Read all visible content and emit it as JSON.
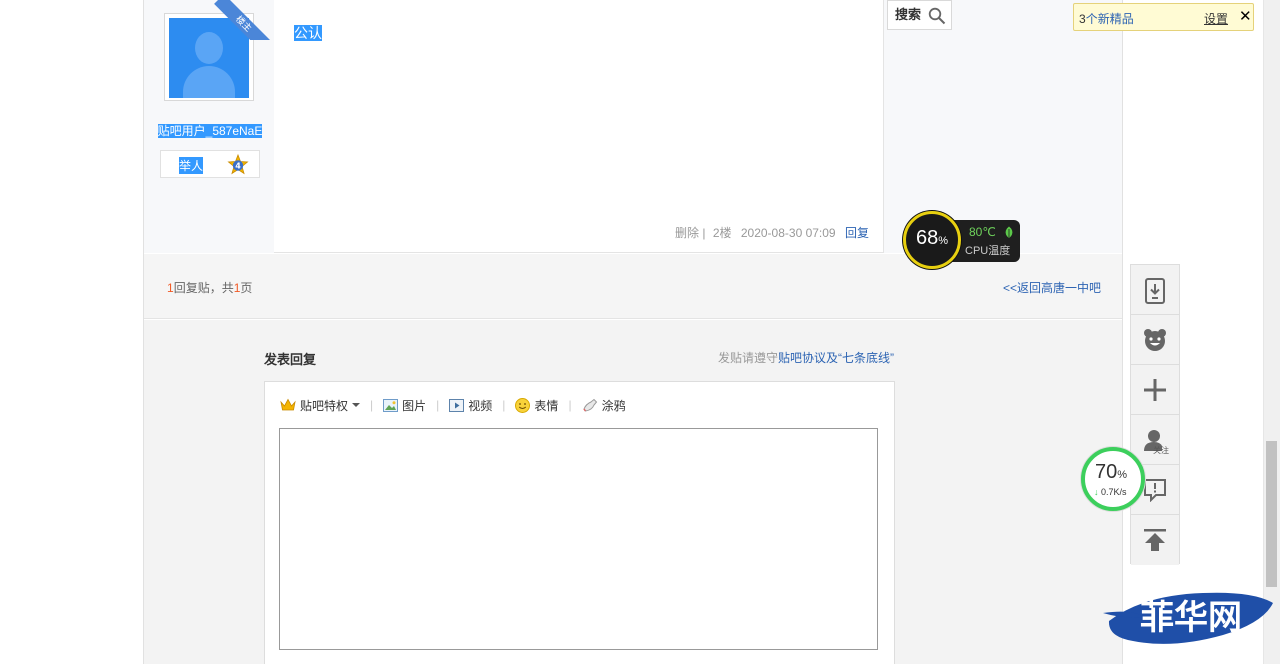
{
  "post": {
    "badge": "楼主",
    "username": "贴吧用户_587eNaE",
    "level_title": "举人",
    "level_num": "4",
    "content": "公认",
    "delete_label": "删除",
    "sep": "|",
    "floor": "2楼",
    "time": "2020-08-30 07:09",
    "reply_label": "回复"
  },
  "search": {
    "label": "搜索"
  },
  "pager": {
    "count": "1",
    "text_mid": "回复贴，共",
    "pages": "1",
    "text_end": "页",
    "back_link": "<<返回高唐一中吧"
  },
  "reply": {
    "title": "发表回复",
    "rules_prefix": "发贴请遵守",
    "rules_link": "贴吧协议及“七条底线”",
    "toolbar": {
      "privilege": "贴吧特权",
      "image": "图片",
      "video": "视频",
      "emoji": "表情",
      "doodle": "涂鸦"
    }
  },
  "notify": {
    "count": "3",
    "text": "个新精品",
    "settings": "设置",
    "close": "✕"
  },
  "cpu": {
    "usage": "68",
    "unit": "%",
    "temp": "80℃",
    "label": "CPU温度"
  },
  "side": {
    "follow_label": "关注"
  },
  "net": {
    "usage": "70",
    "unit": "%",
    "speed": "0.7K/s"
  },
  "watermark": {
    "text": "菲华网"
  },
  "colors": {
    "accent_blue": "#2d64b3",
    "number_red": "#f15a25",
    "cpu_ring": "#e8d010",
    "net_ring": "#3ccf5c",
    "selection": "#3399ff"
  }
}
